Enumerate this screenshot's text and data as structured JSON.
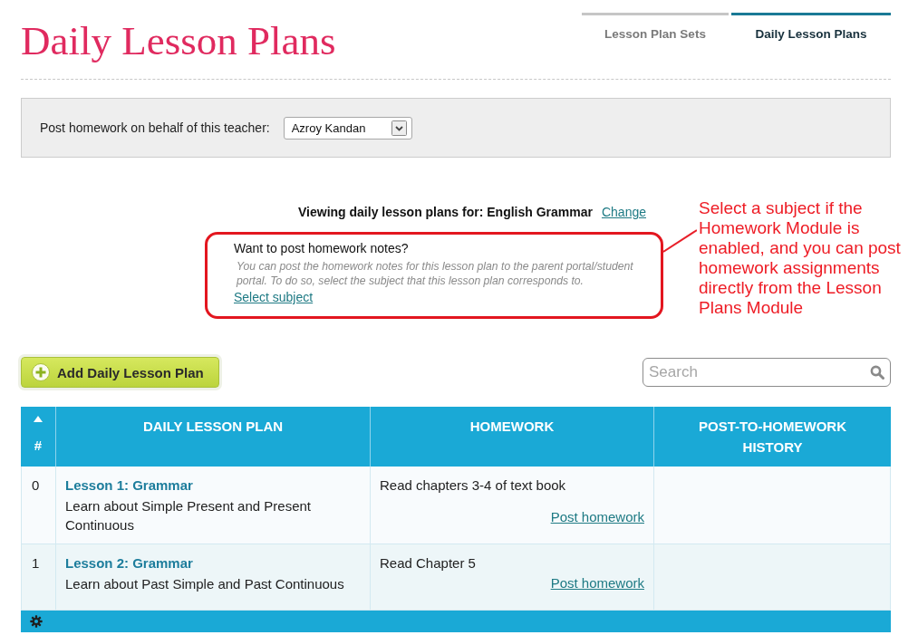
{
  "header": {
    "title": "Daily Lesson Plans",
    "tabs": [
      {
        "label": "Lesson Plan Sets",
        "selected": false
      },
      {
        "label": "Daily Lesson Plans",
        "selected": true
      }
    ]
  },
  "teacher_panel": {
    "label": "Post homework on behalf of this teacher:",
    "teacher_select": {
      "value": "Azroy Kandan"
    }
  },
  "viewing": {
    "text": "Viewing daily lesson plans for: English Grammar",
    "change_link": "Change"
  },
  "homework_notice": {
    "title": "Want to post homework notes?",
    "description": "You can post the homework notes for this lesson plan to the parent portal/student portal. To do so, select the subject that this lesson plan corresponds to.",
    "link": "Select subject"
  },
  "annotation": {
    "text": "Select a subject if the Homework Module is enabled, and you can post homework assignments directly from the Lesson Plans Module"
  },
  "toolbar": {
    "add_button": "Add Daily Lesson Plan",
    "search": {
      "placeholder": "Search"
    }
  },
  "table": {
    "columns": [
      {
        "label": "#",
        "sorted": true
      },
      {
        "label": "DAILY LESSON PLAN",
        "sorted": false
      },
      {
        "label": "HOMEWORK",
        "sorted": false
      },
      {
        "label": "POST-TO-HOMEWORK HISTORY",
        "sorted": false
      }
    ],
    "rows": [
      {
        "number": "0",
        "title": "Lesson 1: Grammar",
        "description": "Learn about Simple Present and Present Continuous",
        "homework": "Read chapters 3-4 of text book",
        "post_link": "Post homework"
      },
      {
        "number": "1",
        "title": "Lesson 2: Grammar",
        "description": "Learn about Past Simple and Past Continuous",
        "homework": "Read Chapter 5",
        "post_link": "Post homework"
      }
    ]
  }
}
